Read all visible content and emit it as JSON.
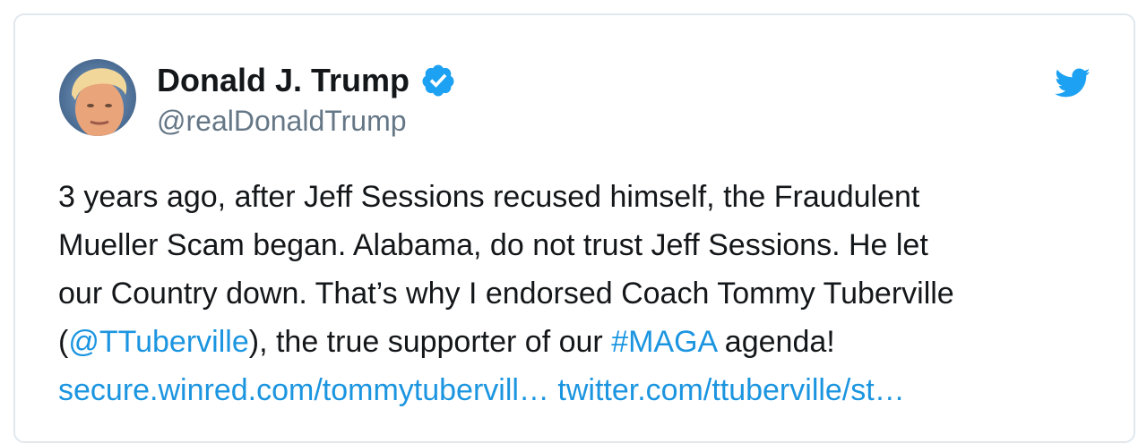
{
  "tweet": {
    "author": {
      "name": "Donald J. Trump",
      "handle": "@realDonaldTrump",
      "verified": true,
      "verified_icon": "verified-badge-icon",
      "avatar_icon": "profile-photo"
    },
    "platform_icon": "twitter-bird-icon",
    "text_lines": [
      "3 years ago, after Jeff Sessions recused himself, the Fraudulent",
      "Mueller Scam began. Alabama, do not trust Jeff Sessions. He let",
      "our Country down. That’s why I endorsed Coach Tommy Tuberville",
      {
        "open_paren": "(",
        "mention": "@TTuberville",
        "middle": "), the true supporter of our ",
        "hashtag": "#MAGA",
        "end": " agenda!"
      },
      {
        "link1": "secure.winred.com/tommytubervill…",
        "link2": "twitter.com/ttuberville/st…"
      }
    ]
  },
  "colors": {
    "text": "#14171a",
    "secondary_text": "#657786",
    "link": "#1b95e0",
    "border": "#e1e8ed",
    "verified": "#1da1f2"
  }
}
